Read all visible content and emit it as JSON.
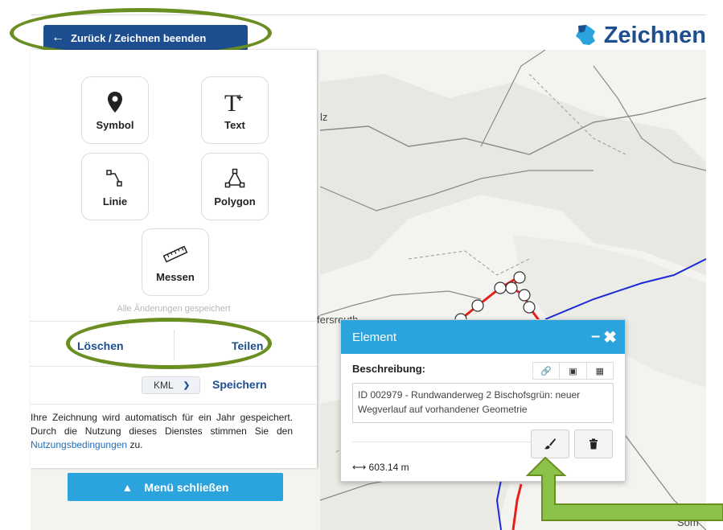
{
  "header": {
    "back_label": "Zurück / Zeichnen beenden",
    "title": "Zeichnen",
    "title_icon": "bavaria-map-icon"
  },
  "tools": [
    {
      "label": "Symbol",
      "icon": "map-marker-icon"
    },
    {
      "label": "Text",
      "icon": "text-plus-icon"
    },
    {
      "label": "Linie",
      "icon": "line-icon"
    },
    {
      "label": "Polygon",
      "icon": "polygon-icon"
    },
    {
      "label": "Messen",
      "icon": "ruler-icon"
    }
  ],
  "sidebar": {
    "saved_note": "Alle Änderungen gespeichert",
    "delete_label": "Löschen",
    "share_label": "Teilen",
    "format_value": "KML",
    "save_label": "Speichern",
    "info_prefix": "Ihre Zeichnung wird automatisch für ein Jahr gespeichert. Durch die Nutzung dieses Dienstes stimmen Sie den ",
    "info_link": "Nutzungsbedingungen",
    "info_suffix": " zu.",
    "close_menu_label": "Menü schließen"
  },
  "panel": {
    "title": "Element",
    "desc_label": "Beschreibung:",
    "desc_value": "ID 002979 - Rundwanderweg 2 Bischofsgrün: neuer Wegverlauf auf vorhandener Geometrie",
    "length": "603.14 m"
  },
  "map": {
    "label_town": "fersreuth",
    "label_corner": "Som",
    "label_fragment": "lz",
    "route_color": "#e8201c",
    "river_color": "#1a2bd6"
  },
  "colors": {
    "primary": "#1d4e8f",
    "accent": "#2ba3dc",
    "annotation": "#6b8e23"
  }
}
